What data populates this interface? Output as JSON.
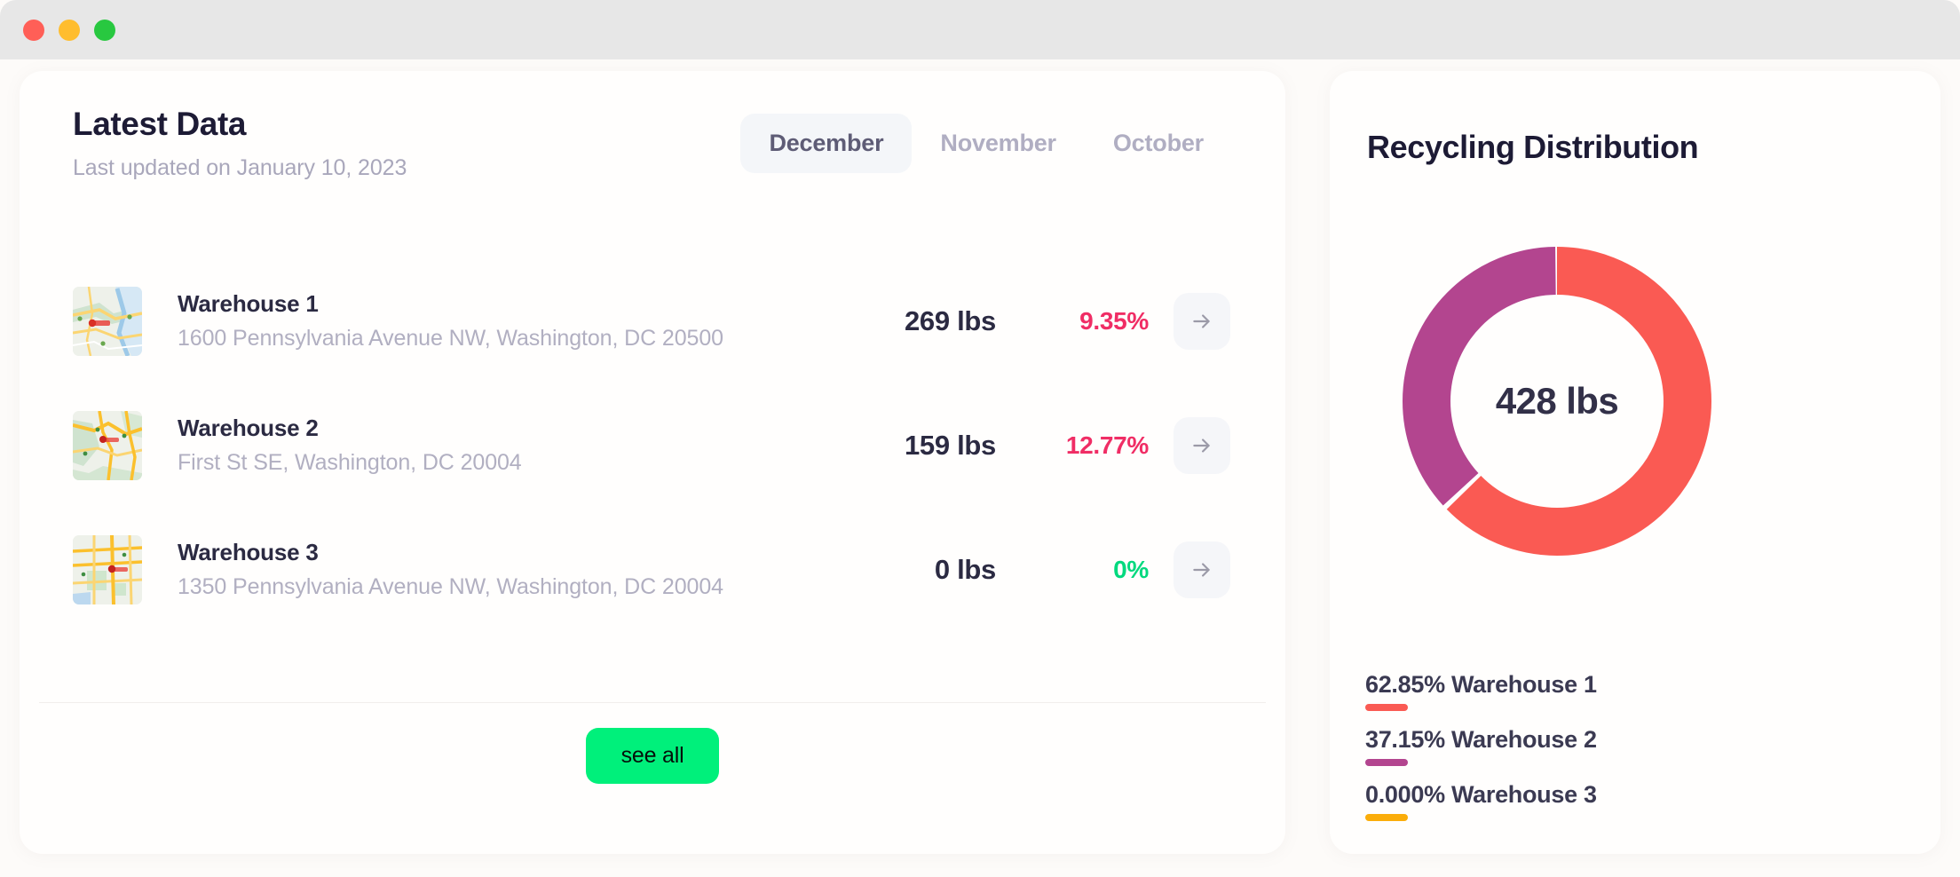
{
  "window": {
    "controls": [
      {
        "name": "close",
        "color": "#ff5f57"
      },
      {
        "name": "minimize",
        "color": "#ffbd2e"
      },
      {
        "name": "maximize",
        "color": "#28c840"
      }
    ]
  },
  "latest_data": {
    "title": "Latest Data",
    "subtitle": "Last updated on January 10, 2023",
    "tabs": [
      {
        "label": "December",
        "active": true
      },
      {
        "label": "November",
        "active": false
      },
      {
        "label": "October",
        "active": false
      }
    ],
    "rows": [
      {
        "name": "Warehouse 1",
        "address": "1600 Pennsylvania Avenue NW, Washington, DC 20500",
        "weight": "269 lbs",
        "percent": "9.35%",
        "percent_state": "down",
        "arrow": "arrow-right-icon",
        "map": "map-thumbnail-icon"
      },
      {
        "name": "Warehouse 2",
        "address": "First St SE, Washington, DC 20004",
        "weight": "159 lbs",
        "percent": "12.77%",
        "percent_state": "down",
        "arrow": "arrow-right-icon",
        "map": "map-thumbnail-icon"
      },
      {
        "name": "Warehouse 3",
        "address": "1350 Pennsylvania Avenue NW, Washington, DC 20004",
        "weight": "0 lbs",
        "percent": "0%",
        "percent_state": "zero",
        "arrow": "arrow-right-icon",
        "map": "map-thumbnail-icon"
      }
    ],
    "see_all_label": "see all"
  },
  "recycling": {
    "title": "Recycling Distribution",
    "center_value": "428 lbs",
    "legend": [
      {
        "label": "62.85% Warehouse 1",
        "color": "#fa5a53"
      },
      {
        "label": "37.15% Warehouse 2",
        "color": "#b3458f"
      },
      {
        "label": "0.000% Warehouse 3",
        "color": "#fbad0a"
      }
    ]
  },
  "chart_data": {
    "type": "pie",
    "title": "Recycling Distribution",
    "subtype": "donut",
    "total": 428,
    "unit": "lbs",
    "center_label": "428 lbs",
    "start_angle_deg": 0,
    "direction": "clockwise",
    "legend_position": "bottom-left",
    "categories": [
      "Warehouse 1",
      "Warehouse 2",
      "Warehouse 3"
    ],
    "values": [
      269,
      159,
      0
    ],
    "percentages": [
      62.85,
      37.15,
      0.0
    ],
    "colors": [
      "#fa5a53",
      "#b3458f",
      "#fbad0a"
    ],
    "labels": [
      "62.85% Warehouse 1",
      "37.15% Warehouse 2",
      "0.000% Warehouse 3"
    ]
  },
  "colors": {
    "accent_green": "#00f07b",
    "negative_red": "#f02d65",
    "positive_green": "#00d97e",
    "slice_1": "#fa5a53",
    "slice_2": "#b3458f",
    "slice_3": "#fbad0a",
    "text_dark": "#1d1b35",
    "text_muted": "#b1afc1",
    "card_bg": "#fffefd",
    "page_bg": "#fdfbf9",
    "titlebar_bg": "#e7e7e7"
  }
}
